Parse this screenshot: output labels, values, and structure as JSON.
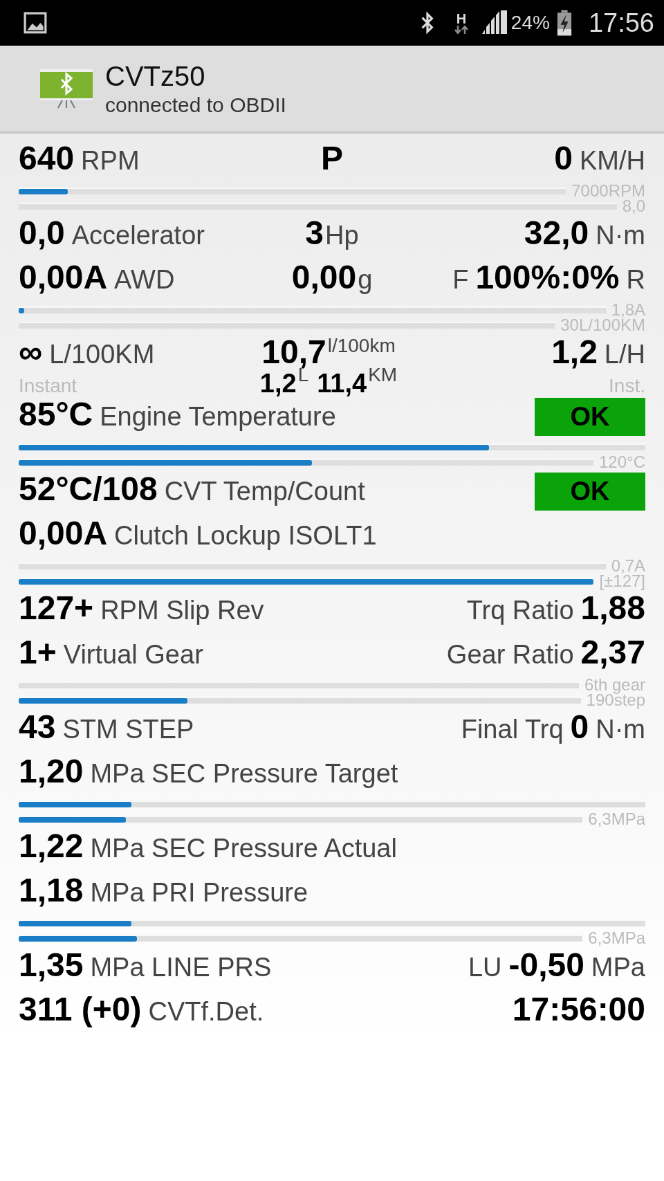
{
  "status_bar": {
    "network_type": "H",
    "battery": "24%",
    "time": "17:56"
  },
  "action_bar": {
    "title": "CVTz50",
    "subtitle": "connected to OBDII"
  },
  "blocks": [
    {
      "kind": "line",
      "left": [
        {
          "kind": "value",
          "text": "640"
        },
        {
          "kind": "unit",
          "text": "RPM"
        }
      ],
      "center": [
        {
          "kind": "value",
          "text": "P"
        }
      ],
      "right": [
        {
          "kind": "value",
          "text": "0"
        },
        {
          "kind": "unit",
          "text": "KM/H"
        }
      ]
    },
    {
      "kind": "bar",
      "level": 0.09,
      "scale": "7000RPM"
    },
    {
      "kind": "bar",
      "level": 0,
      "scale": "8,0"
    },
    {
      "kind": "line",
      "left": [
        {
          "kind": "value",
          "text": "0,0"
        },
        {
          "kind": "unit",
          "text": "Accelerator"
        }
      ],
      "center": [
        {
          "kind": "value",
          "text": "3"
        },
        {
          "kind": "unit",
          "text": "Hp"
        }
      ],
      "right": [
        {
          "kind": "value",
          "text": "32,0"
        },
        {
          "kind": "unit",
          "text": "N·m"
        }
      ]
    },
    {
      "kind": "line",
      "left": [
        {
          "kind": "value",
          "text": "0,00A"
        },
        {
          "kind": "unit",
          "text": "AWD"
        }
      ],
      "center": [
        {
          "kind": "value",
          "text": "0,00"
        },
        {
          "kind": "unit",
          "text": "g"
        }
      ],
      "right": [
        {
          "kind": "unit",
          "text": "F"
        },
        {
          "kind": "value",
          "text": "100%:0%"
        },
        {
          "kind": "unit",
          "text": "R"
        }
      ]
    },
    {
      "kind": "bar",
      "level": 0.01,
      "scale": "1,8A"
    },
    {
      "kind": "bar",
      "level": 0,
      "scale": "30L/100KM"
    },
    {
      "kind": "line",
      "left": [
        {
          "kind": "value",
          "text": "∞"
        },
        {
          "kind": "unit",
          "text": "L/100KM"
        }
      ],
      "center": [
        {
          "kind": "value",
          "text": "10,7"
        },
        {
          "kind": "sup",
          "text": "l/100km"
        }
      ],
      "right": [
        {
          "kind": "value",
          "text": "1,2"
        },
        {
          "kind": "unit",
          "text": "L/H"
        }
      ]
    },
    {
      "kind": "subline",
      "left": [
        {
          "kind": "caption",
          "text": "Instant"
        }
      ],
      "center": [
        {
          "kind": "value",
          "text": "1,2"
        },
        {
          "kind": "sup",
          "text": "L"
        },
        {
          "kind": "value",
          "text": "11,4"
        },
        {
          "kind": "sup",
          "text": "KM"
        }
      ],
      "right": [
        {
          "kind": "caption",
          "text": "Inst."
        }
      ]
    },
    {
      "kind": "line",
      "left": [
        {
          "kind": "value",
          "text": "85°C"
        },
        {
          "kind": "unit",
          "text": "Engine Temperature"
        }
      ],
      "right": [
        {
          "kind": "badge",
          "text": "OK"
        }
      ]
    },
    {
      "kind": "bar",
      "level": 0.75
    },
    {
      "kind": "bar",
      "level": 0.51,
      "scale": "120°C"
    },
    {
      "kind": "line",
      "left": [
        {
          "kind": "value",
          "text": "52°C/108"
        },
        {
          "kind": "unit",
          "text": "CVT Temp/Count"
        }
      ],
      "right": [
        {
          "kind": "badge",
          "text": "OK"
        }
      ]
    },
    {
      "kind": "line",
      "left": [
        {
          "kind": "value",
          "text": "0,00A"
        },
        {
          "kind": "unit",
          "text": "Clutch Lockup ISOLT1"
        }
      ]
    },
    {
      "kind": "bar",
      "level": 0,
      "scale": "0,7A"
    },
    {
      "kind": "bar",
      "level": 1,
      "scale": "[±127]"
    },
    {
      "kind": "line",
      "left": [
        {
          "kind": "value",
          "text": "127+"
        },
        {
          "kind": "unit",
          "text": "RPM Slip Rev"
        }
      ],
      "right": [
        {
          "kind": "unit",
          "text": "Trq Ratio"
        },
        {
          "kind": "value",
          "text": "1,88"
        }
      ]
    },
    {
      "kind": "line",
      "left": [
        {
          "kind": "value",
          "text": "1+"
        },
        {
          "kind": "unit",
          "text": "Virtual Gear"
        }
      ],
      "right": [
        {
          "kind": "unit",
          "text": "Gear Ratio"
        },
        {
          "kind": "value",
          "text": "2,37"
        }
      ]
    },
    {
      "kind": "bar",
      "level": 0,
      "scale": "6th gear"
    },
    {
      "kind": "bar",
      "level": 0.3,
      "scale": "190step"
    },
    {
      "kind": "line",
      "left": [
        {
          "kind": "value",
          "text": "43"
        },
        {
          "kind": "unit",
          "text": "STM STEP"
        }
      ],
      "right": [
        {
          "kind": "unit",
          "text": "Final Trq"
        },
        {
          "kind": "value",
          "text": "0"
        },
        {
          "kind": "unit",
          "text": "N·m"
        }
      ]
    },
    {
      "kind": "line",
      "left": [
        {
          "kind": "value",
          "text": "1,20"
        },
        {
          "kind": "unit",
          "text": "MPa SEC Pressure Target"
        }
      ]
    },
    {
      "kind": "bar",
      "level": 0.18
    },
    {
      "kind": "bar",
      "level": 0.19,
      "scale": "6,3MPa"
    },
    {
      "kind": "line",
      "left": [
        {
          "kind": "value",
          "text": "1,22"
        },
        {
          "kind": "unit",
          "text": "MPa SEC Pressure Actual"
        }
      ]
    },
    {
      "kind": "line",
      "left": [
        {
          "kind": "value",
          "text": "1,18"
        },
        {
          "kind": "unit",
          "text": "MPa PRI Pressure"
        }
      ]
    },
    {
      "kind": "bar",
      "level": 0.18
    },
    {
      "kind": "bar",
      "level": 0.21,
      "scale": "6,3MPa"
    },
    {
      "kind": "line",
      "left": [
        {
          "kind": "value",
          "text": "1,35"
        },
        {
          "kind": "unit",
          "text": "MPa LINE PRS"
        }
      ],
      "right": [
        {
          "kind": "unit",
          "text": "LU"
        },
        {
          "kind": "value",
          "text": "-0,50"
        },
        {
          "kind": "unit",
          "text": "MPa"
        }
      ]
    },
    {
      "kind": "line",
      "left": [
        {
          "kind": "value",
          "text": "311 (+0)"
        },
        {
          "kind": "unit",
          "text": "CVTf.Det."
        }
      ],
      "right": [
        {
          "kind": "value",
          "text": "17:56:00"
        }
      ]
    }
  ]
}
